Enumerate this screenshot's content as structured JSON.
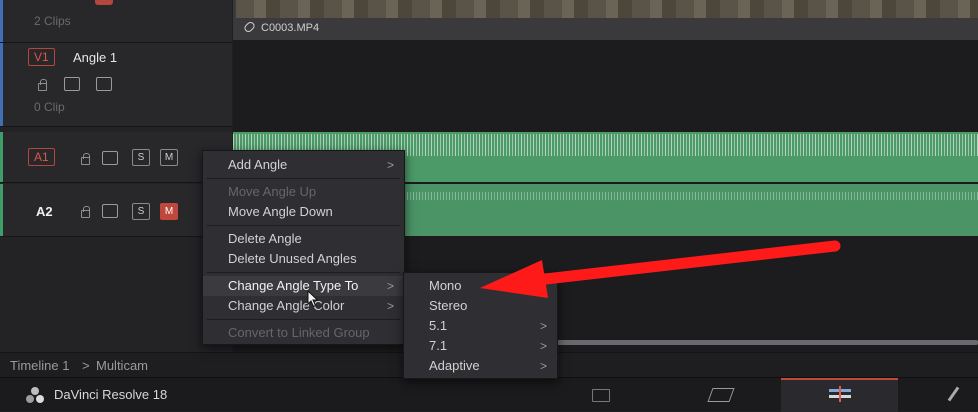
{
  "tracks": {
    "top_partial": {
      "clips_count": "2 Clips"
    },
    "v1": {
      "tag": "V1",
      "name": "Angle 1",
      "clips_count": "0 Clip"
    },
    "a1": {
      "tag": "A1",
      "solo": "S",
      "mute": "M"
    },
    "a2": {
      "tag": "A2",
      "solo": "S",
      "mute": "M"
    }
  },
  "clip": {
    "name": "C0003.MP4"
  },
  "breadcrumb": {
    "timeline": "Timeline 1",
    "separator": ">",
    "current": "Multicam"
  },
  "app": {
    "name": "DaVinci Resolve 18"
  },
  "context_menu": {
    "items": [
      {
        "label": "Add Angle",
        "submenu": ">"
      },
      {
        "label": "Move Angle Up"
      },
      {
        "label": "Move Angle Down"
      },
      {
        "label": "Delete Angle"
      },
      {
        "label": "Delete Unused Angles"
      },
      {
        "label": "Change Angle Type To",
        "submenu": ">"
      },
      {
        "label": "Change Angle Color",
        "submenu": ">"
      },
      {
        "label": "Convert to Linked Group"
      }
    ]
  },
  "submenu": {
    "items": [
      {
        "label": "Mono"
      },
      {
        "label": "Stereo"
      },
      {
        "label": "5.1",
        "submenu": ">"
      },
      {
        "label": "7.1",
        "submenu": ">"
      },
      {
        "label": "Adaptive",
        "submenu": ">"
      }
    ]
  },
  "colors": {
    "accent_red": "#c7463c",
    "audio_green": "#4c9a68",
    "annotation_arrow": "#ff1a1a"
  }
}
